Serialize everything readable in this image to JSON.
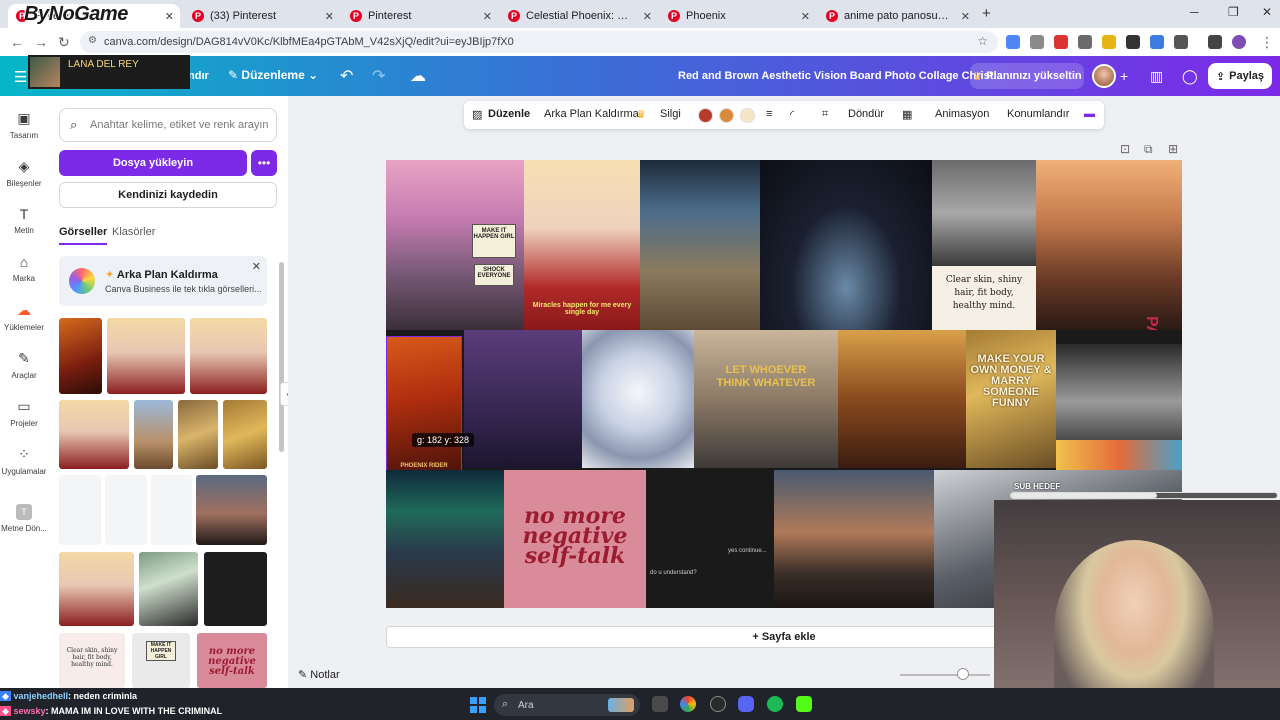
{
  "browser": {
    "tabs": [
      {
        "label": "Pinterest"
      },
      {
        "label": "(33) Pinterest"
      },
      {
        "label": "Pinterest"
      },
      {
        "label": "Celestial Phoenix: Golden Asce"
      },
      {
        "label": "Phoenix"
      },
      {
        "label": "anime pato panosundaki Pin"
      }
    ],
    "url": "canva.com/design/DAG814vV0Kc/KlbfMEa4pGTAbM_V42sXjQ/edit?ui=eyJBIjp7fX0"
  },
  "overlay": {
    "brand": "ByNoGame",
    "now_playing": "LANA DEL REY",
    "sub_goal_label": "SUB HEDEF",
    "sub_goal_progress": 0.55
  },
  "header": {
    "fragment": "ndır",
    "edit_label": "Düzenleme",
    "doc_title": "Red and Brown Aesthetic Vision Board Photo Collage Christ...",
    "upgrade_label": "Planınızı yükseltin",
    "share_label": "Paylaş"
  },
  "rail": [
    {
      "label": "Tasarım",
      "icon": "layout-icon"
    },
    {
      "label": "Bileşenler",
      "icon": "shapes-icon"
    },
    {
      "label": "Metin",
      "icon": "text-icon"
    },
    {
      "label": "Marka",
      "icon": "brand-icon"
    },
    {
      "label": "Yüklemeler",
      "icon": "upload-cloud-icon"
    },
    {
      "label": "Araçlar",
      "icon": "pen-icon"
    },
    {
      "label": "Projeler",
      "icon": "folder-icon"
    },
    {
      "label": "Uygulamalar",
      "icon": "apps-icon"
    },
    {
      "label": "Metne Dön...",
      "icon": "text-convert-icon"
    }
  ],
  "panel": {
    "search_placeholder": "Anahtar kelime, etiket ve renk arayın",
    "upload_label": "Dosya yükleyin",
    "record_label": "Kendinizi kaydedin",
    "tabs": [
      "Görseller",
      "Klasörler"
    ],
    "promo_title": "Arka Plan Kaldırma",
    "promo_sub": "Canva Business ile tek tıkla görselleri...",
    "thumb_texts": {
      "clear": "Clear skin, shiny hair, fit body, healthy mind.",
      "make": "MAKE IT HAPPEN GIRL",
      "nomore": "no more negative self-talk"
    }
  },
  "toolbar": {
    "edit": "Düzenle",
    "bg_remove": "Arka Plan Kaldırma",
    "erase": "Silgi",
    "colors": [
      "#b83a2a",
      "#d98a3a",
      "#f5e6c4"
    ],
    "rotate": "Döndür",
    "animate": "Animasyon",
    "position": "Konumlandır"
  },
  "canvas": {
    "make_it": "MAKE IT HAPPEN GIRL",
    "shock": "SHOCK EVERYONE",
    "miracles": "Miracles happen for me every single day",
    "clear_skin": "Clear skin, shiny hair, fit body, healthy mind.",
    "let_whoever": "LET WHOEVER THINK WHATEVER",
    "make_money": "MAKE YOUR OWN MONEY & MARRY SOMEONE FUNNY",
    "parcels": "PARCELS",
    "phoenix": "PHOENIX RIDER",
    "no_more": "no more negative self-talk",
    "yes_continue": "yes continue...",
    "do_u": "do u understand?",
    "coord": "g: 182 y: 328"
  },
  "footer": {
    "add_page": "+ Sayfa ekle",
    "notes": "Notlar"
  },
  "chat": [
    {
      "user": "vanjehedhell",
      "msg": ": neden criminla"
    },
    {
      "user": "sewsky",
      "msg": ": MAMA IM IN LOVE WITH THE CRIMINAL"
    }
  ],
  "taskbar": {
    "search_placeholder": "Ara"
  }
}
